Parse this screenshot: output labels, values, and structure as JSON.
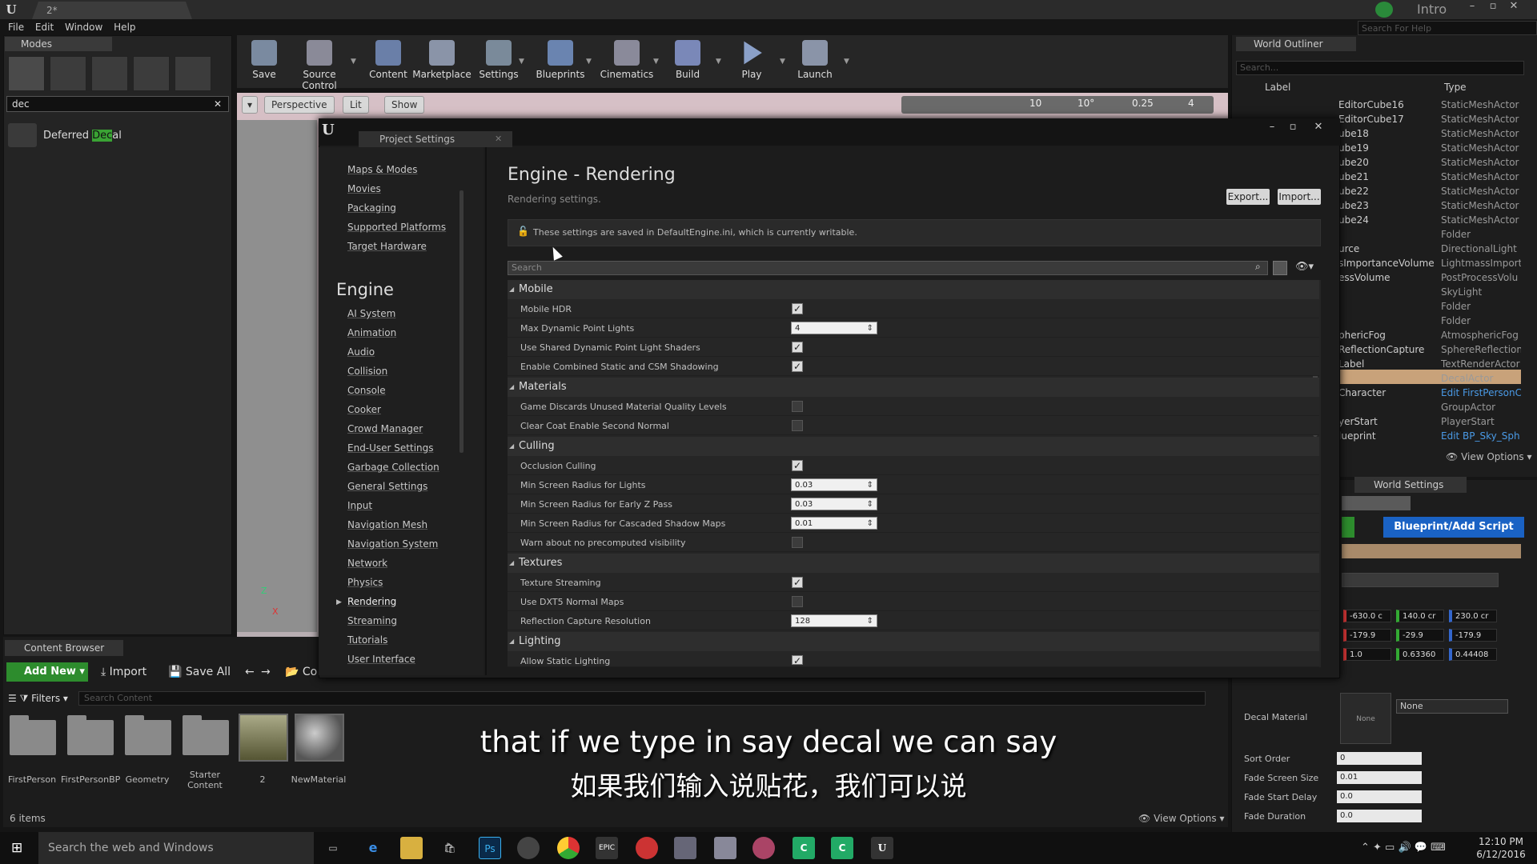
{
  "window": {
    "doc_tab": "2*",
    "intro_label": "Intro",
    "help_search_placeholder": "Search For Help"
  },
  "menu": [
    "File",
    "Edit",
    "Window",
    "Help"
  ],
  "modes": {
    "tab": "Modes",
    "search_value": "dec",
    "result_pre": "Deferred ",
    "result_highlight": "Dec",
    "result_post": "al"
  },
  "toolbar": {
    "buttons": [
      "Save",
      "Source Control",
      "Content",
      "Marketplace",
      "Settings",
      "Blueprints",
      "Cinematics",
      "Build",
      "Play",
      "Launch"
    ]
  },
  "viewport": {
    "perspective": "Perspective",
    "lit": "Lit",
    "show": "Show",
    "grid_snap": "10",
    "rot_snap": "10°",
    "scale_snap": "0.25",
    "camera_speed": "4",
    "axis_z": "Z",
    "axis_x": "X"
  },
  "project_settings": {
    "tab": "Project Settings",
    "title": "Engine - Rendering",
    "subtitle": "Rendering settings.",
    "export": "Export...",
    "import": "Import...",
    "info": "These settings are saved in DefaultEngine.ini, which is currently writable.",
    "search_placeholder": "Search",
    "nav_top": [
      "Maps & Modes",
      "Movies",
      "Packaging",
      "Supported Platforms",
      "Target Hardware"
    ],
    "nav_heading": "Engine",
    "nav_engine": [
      "AI System",
      "Animation",
      "Audio",
      "Collision",
      "Console",
      "Cooker",
      "Crowd Manager",
      "End-User Settings",
      "Garbage Collection",
      "General Settings",
      "Input",
      "Navigation Mesh",
      "Navigation System",
      "Network",
      "Physics",
      "Rendering",
      "Streaming",
      "Tutorials",
      "User Interface"
    ],
    "categories": {
      "mobile": "Mobile",
      "materials": "Materials",
      "culling": "Culling",
      "textures": "Textures",
      "lighting": "Lighting"
    },
    "props": {
      "mobile_hdr": {
        "label": "Mobile HDR",
        "checked": true
      },
      "max_dyn_lights": {
        "label": "Max Dynamic Point Lights",
        "value": "4"
      },
      "shared_shaders": {
        "label": "Use Shared Dynamic Point Light Shaders",
        "checked": true
      },
      "csm_shadowing": {
        "label": "Enable Combined Static and CSM Shadowing",
        "checked": true
      },
      "discard_levels": {
        "label": "Game Discards Unused Material Quality Levels",
        "checked": false
      },
      "clear_coat": {
        "label": "Clear Coat Enable Second Normal",
        "checked": false
      },
      "occlusion": {
        "label": "Occlusion Culling",
        "checked": true
      },
      "min_lights": {
        "label": "Min Screen Radius for Lights",
        "value": "0.03"
      },
      "min_early_z": {
        "label": "Min Screen Radius for Early Z Pass",
        "value": "0.03"
      },
      "min_csm": {
        "label": "Min Screen Radius for Cascaded Shadow Maps",
        "value": "0.01"
      },
      "warn_visibility": {
        "label": "Warn about no precomputed visibility",
        "checked": false
      },
      "tex_streaming": {
        "label": "Texture Streaming",
        "checked": true
      },
      "dxt5": {
        "label": "Use DXT5 Normal Maps",
        "checked": false
      },
      "refl_res": {
        "label": "Reflection Capture Resolution",
        "value": "128"
      },
      "static_lighting": {
        "label": "Allow Static Lighting",
        "checked": true
      }
    }
  },
  "outliner": {
    "tab": "World Outliner",
    "search_placeholder": "Search...",
    "col_label": "Label",
    "col_type": "Type",
    "rows": [
      {
        "name": "EditorCube16",
        "type": "StaticMeshActor"
      },
      {
        "name": "EditorCube17",
        "type": "StaticMeshActor"
      },
      {
        "name": "ube18",
        "type": "StaticMeshActor"
      },
      {
        "name": "ube19",
        "type": "StaticMeshActor"
      },
      {
        "name": "ube20",
        "type": "StaticMeshActor"
      },
      {
        "name": "ube21",
        "type": "StaticMeshActor"
      },
      {
        "name": "ube22",
        "type": "StaticMeshActor"
      },
      {
        "name": "ube23",
        "type": "StaticMeshActor"
      },
      {
        "name": "ube24",
        "type": "StaticMeshActor"
      },
      {
        "name": "",
        "type": "Folder"
      },
      {
        "name": "urce",
        "type": "DirectionalLight"
      },
      {
        "name": "sImportanceVolume",
        "type": "LightmassImporta"
      },
      {
        "name": "essVolume",
        "type": "PostProcessVolu"
      },
      {
        "name": "",
        "type": "SkyLight"
      },
      {
        "name": "",
        "type": "Folder"
      },
      {
        "name": "",
        "type": "Folder"
      },
      {
        "name": "phericFog",
        "type": "AtmosphericFog"
      },
      {
        "name": "ReflectionCapture",
        "type": "SphereReflectionC"
      },
      {
        "name": "Label",
        "type": "TextRenderActor"
      },
      {
        "name": "",
        "type": "DecalActor"
      },
      {
        "name": "Character",
        "type": "Edit FirstPersonC"
      },
      {
        "name": "",
        "type": "GroupActor"
      },
      {
        "name": "yerStart",
        "type": "PlayerStart"
      },
      {
        "name": "lueprint",
        "type": "Edit BP_Sky_Sph"
      }
    ],
    "view_options": "View Options"
  },
  "details": {
    "ws_tab": "World Settings",
    "blueprint_btn": "Blueprint/Add Script",
    "loc": [
      "-630.0 c",
      "140.0 cr",
      "230.0 cr"
    ],
    "rot": [
      "-179.9",
      "-29.9",
      "-179.9"
    ],
    "scale": [
      "1.0",
      "0.63360",
      "0.44408"
    ],
    "decal_material_label": "Decal Material",
    "decal_material_thumb": "None",
    "decal_material_value": "None",
    "sort_order": {
      "label": "Sort Order",
      "value": "0"
    },
    "fade_screen_size": {
      "label": "Fade Screen Size",
      "value": "0.01"
    },
    "fade_start_delay": {
      "label": "Fade Start Delay",
      "value": "0.0"
    },
    "fade_duration": {
      "label": "Fade Duration",
      "value": "0.0"
    }
  },
  "content_browser": {
    "tab": "Content Browser",
    "add_new": "Add New",
    "import": "Import",
    "save_all": "Save All",
    "path_stub": "Co",
    "filters": "Filters",
    "search_placeholder": "Search Content",
    "assets": [
      "FirstPerson",
      "FirstPersonBP",
      "Geometry",
      "Starter Content",
      "2",
      "NewMaterial"
    ],
    "items": "6 items",
    "view_options": "View Options"
  },
  "subtitles": {
    "en": "that if we type in say decal we can say",
    "zh": "如果我们输入说贴花，我们可以说"
  },
  "taskbar": {
    "search": "Search the web and Windows",
    "time": "12:10 PM",
    "date": "6/12/2016"
  }
}
